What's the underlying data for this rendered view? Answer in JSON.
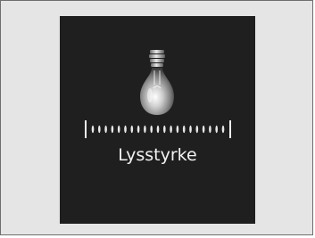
{
  "screen": {
    "background_color": "#e5e5e5",
    "panel_color": "#1f1f1f",
    "icon": "light-bulb-icon",
    "label": "Lysstyrke",
    "brightness": {
      "steps": 21
    }
  }
}
